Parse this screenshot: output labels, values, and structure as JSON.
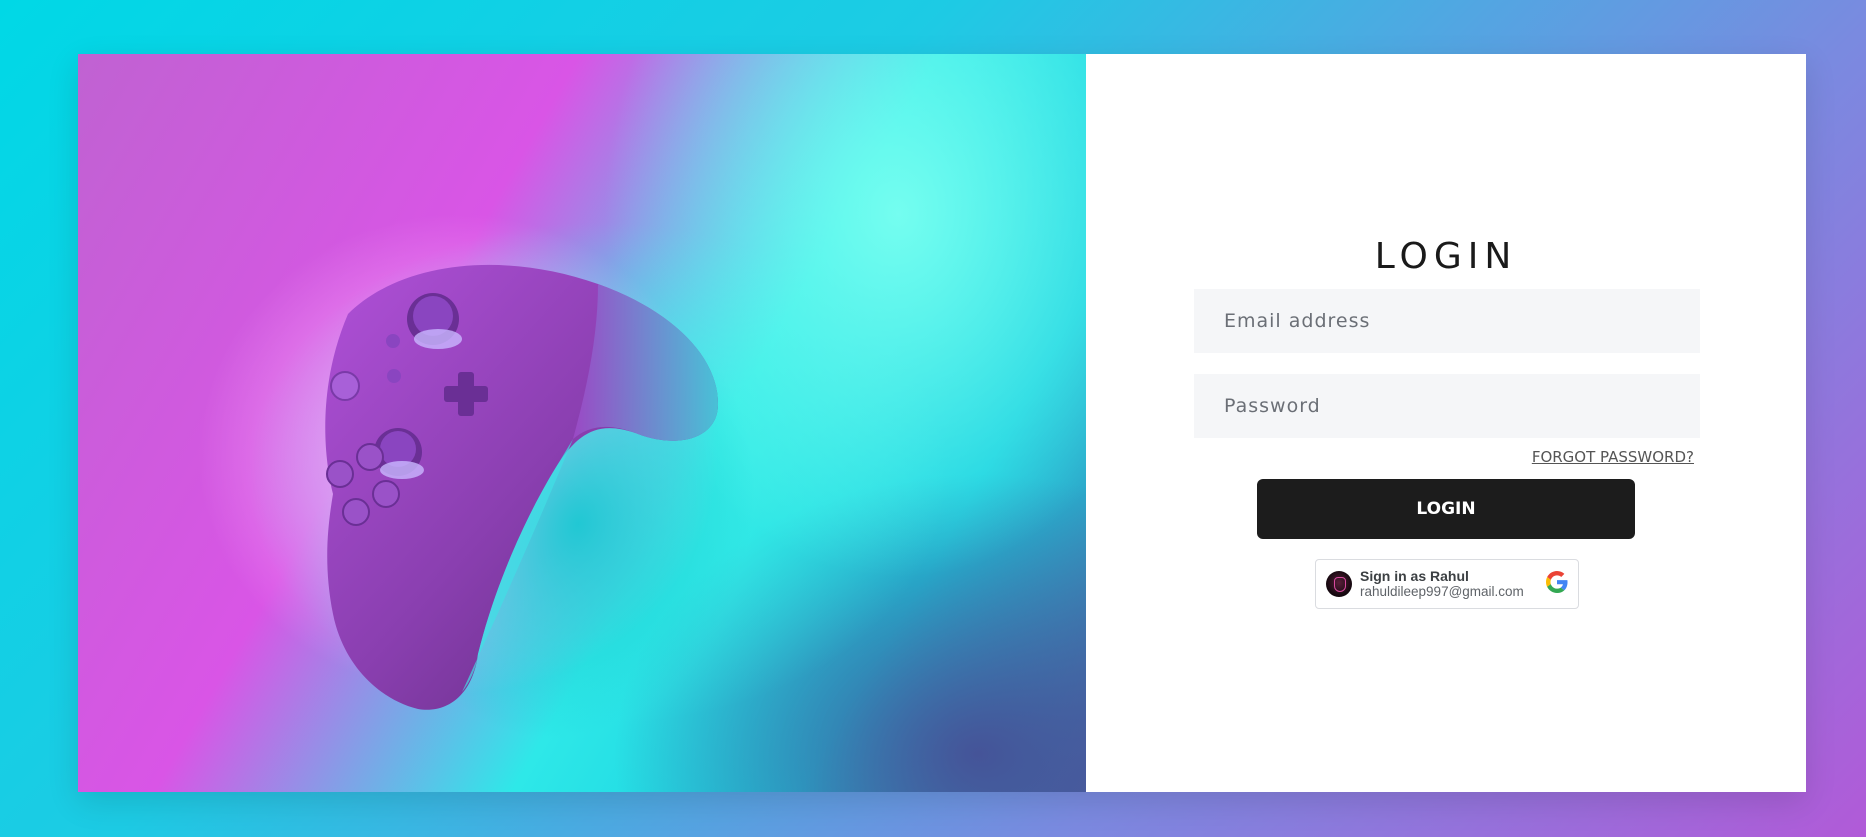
{
  "login": {
    "title": "LOGIN",
    "email_placeholder": "Email address",
    "password_placeholder": "Password",
    "forgot_password": "FORGOT PASSWORD?",
    "login_button": "LOGIN"
  },
  "google_signin": {
    "label": "Sign in as Rahul",
    "email": "rahuldileep997@gmail.com"
  },
  "icons": [
    "game-controller-image",
    "google-icon",
    "avatar"
  ],
  "colors": {
    "button_bg": "#1c1c1c",
    "field_bg": "#f5f6f8",
    "bg_gradient_start": "#00d8e6",
    "bg_gradient_end": "#b15ad8"
  }
}
